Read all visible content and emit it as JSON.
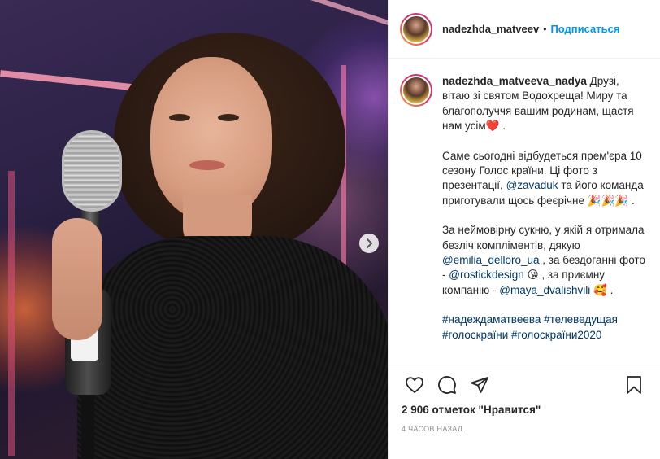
{
  "post": {
    "username": "nadezhda_matveev",
    "separator": "•",
    "follow_label": "Подписаться"
  },
  "caption": {
    "username": "nadezhda_matveeva_nadya",
    "p1": "Друзі, вітаю зі святом Водохреща! Миру та благополуччя вашим родинам, щастя нам усім",
    "p1_emoji": "❤️",
    "p1_end": " .",
    "p2_a": "Саме сьогодні відбудеться прем'єра 10 сезону Голос країни. Ці фото з презентації, ",
    "p2_mention": "@zavaduk",
    "p2_b": " та його команда приготували щось феєрічне ",
    "p2_emoji": "🎉🎉🎉",
    "p2_end": " .",
    "p3_a": "За неймовірну сукню, у якій я отримала безліч компліментів, дякую ",
    "p3_mention1": "@emilia_delloro_ua",
    "p3_b": " , за бездоганні фото - ",
    "p3_mention2": "@rostickdesign",
    "p3_emoji1": "😘",
    "p3_c": " , за приємну компанію - ",
    "p3_mention3": "@maya_dvalishvili",
    "p3_emoji2": "🥰",
    "p3_end": " .",
    "hashtags": "#надеждаматвеева #телеведущая #голоскраїни #голоскраїни2020"
  },
  "stats": {
    "likes": "2 906 отметок \"Нравится\"",
    "time": "4 часов назад"
  },
  "icons": {
    "like": "heart-icon",
    "comment": "comment-icon",
    "share": "share-icon",
    "save": "bookmark-icon",
    "next": "chevron-right-icon"
  },
  "colors": {
    "link": "#00376b",
    "follow": "#0095f6",
    "muted": "#8e8e8e"
  }
}
